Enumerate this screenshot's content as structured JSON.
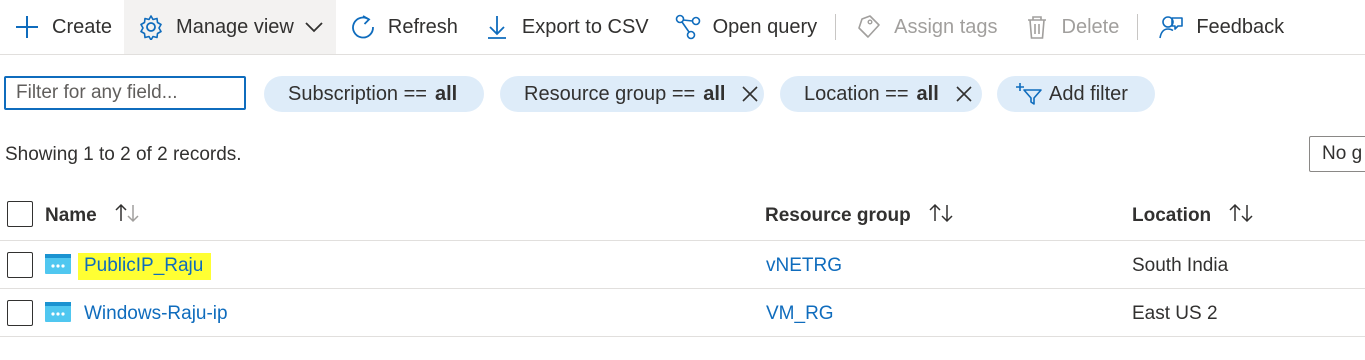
{
  "toolbar": {
    "create": "Create",
    "manage_view": "Manage view",
    "refresh": "Refresh",
    "export_csv": "Export to CSV",
    "open_query": "Open query",
    "assign_tags": "Assign tags",
    "delete": "Delete",
    "feedback": "Feedback"
  },
  "filters": {
    "placeholder": "Filter for any field...",
    "subscription": {
      "label": "Subscription ==",
      "value": "all"
    },
    "resource_group": {
      "label": "Resource group ==",
      "value": "all"
    },
    "location": {
      "label": "Location ==",
      "value": "all"
    },
    "add_filter": "Add filter"
  },
  "records_text": "Showing 1 to 2 of 2 records.",
  "grouping": "No g",
  "table": {
    "columns": {
      "name": "Name",
      "resource_group": "Resource group",
      "location": "Location"
    },
    "rows": [
      {
        "name": "PublicIP_Raju",
        "resource_group": "vNETRG",
        "location": "South India",
        "highlighted": true
      },
      {
        "name": "Windows-Raju-ip",
        "resource_group": "VM_RG",
        "location": "East US 2",
        "highlighted": false
      }
    ]
  },
  "colors": {
    "accent": "#0f6cbd",
    "pill": "#deecf9",
    "highlight": "#ffff33",
    "icon": "#50c7f0"
  }
}
